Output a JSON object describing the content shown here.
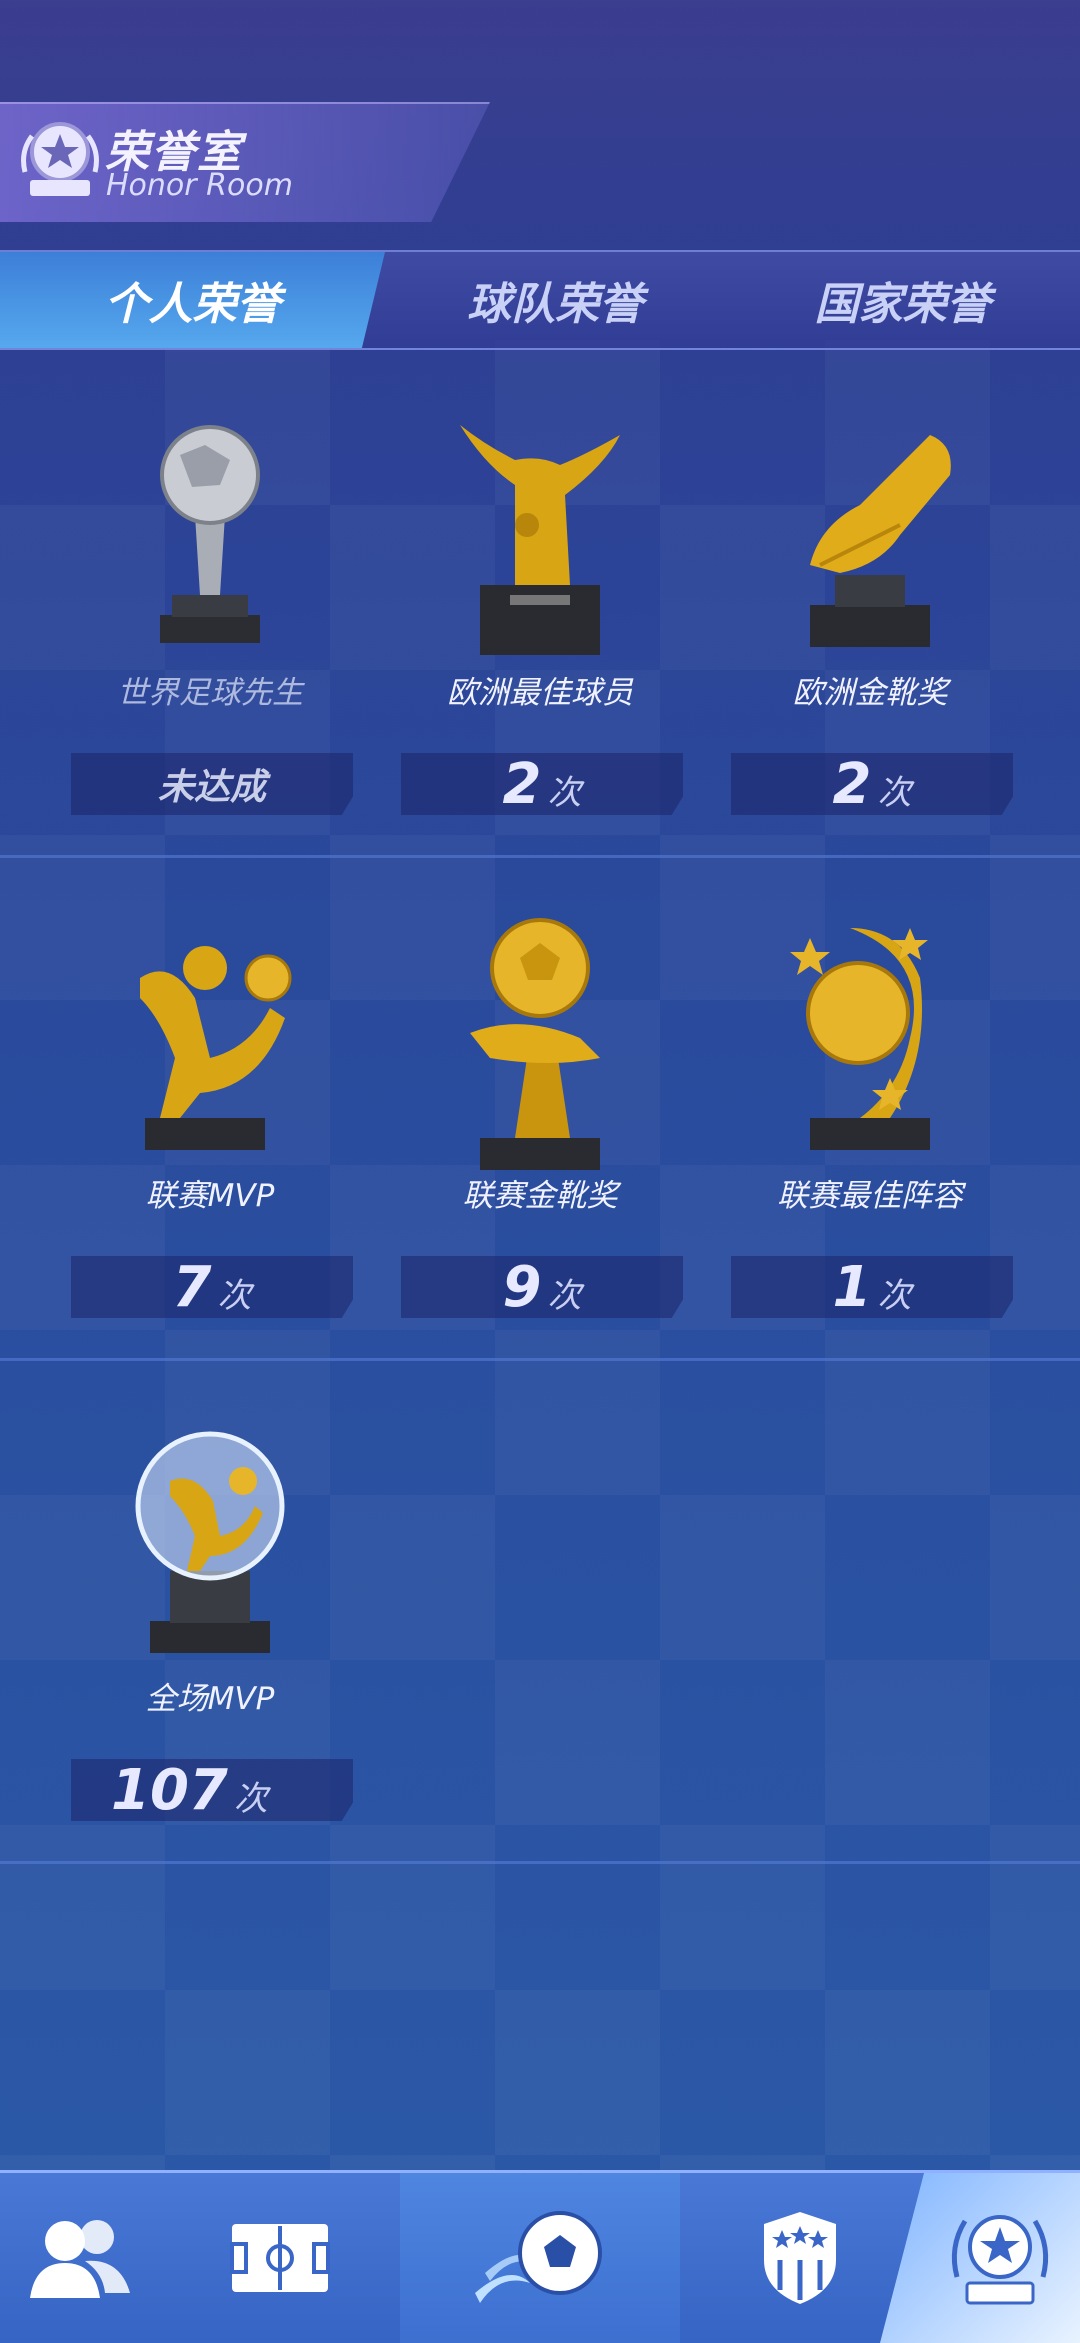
{
  "header": {
    "title": "荣誉室",
    "subtitle": "Honor Room"
  },
  "tabs": [
    {
      "label": "个人荣誉",
      "active": true
    },
    {
      "label": "球队荣誉",
      "active": false
    },
    {
      "label": "国家荣誉",
      "active": false
    }
  ],
  "honors": [
    {
      "name": "世界足球先生",
      "status": "未达成",
      "achieved": false
    },
    {
      "name": "欧洲最佳球员",
      "count": "2",
      "unit": "次"
    },
    {
      "name": "欧洲金靴奖",
      "count": "2",
      "unit": "次"
    },
    {
      "name": "联赛MVP",
      "count": "7",
      "unit": "次"
    },
    {
      "name": "联赛金靴奖",
      "count": "9",
      "unit": "次"
    },
    {
      "name": "联赛最佳阵容",
      "count": "1",
      "unit": "次"
    },
    {
      "name": "全场MVP",
      "count": "107",
      "unit": "次"
    }
  ],
  "bottom_nav": [
    "players-icon",
    "pitch-icon",
    "ball-icon",
    "club-badge-icon",
    "trophy-icon"
  ],
  "colors": {
    "gold": "#d8a514",
    "silver": "#b9bcc4",
    "tab_active": "#4a96e4"
  }
}
